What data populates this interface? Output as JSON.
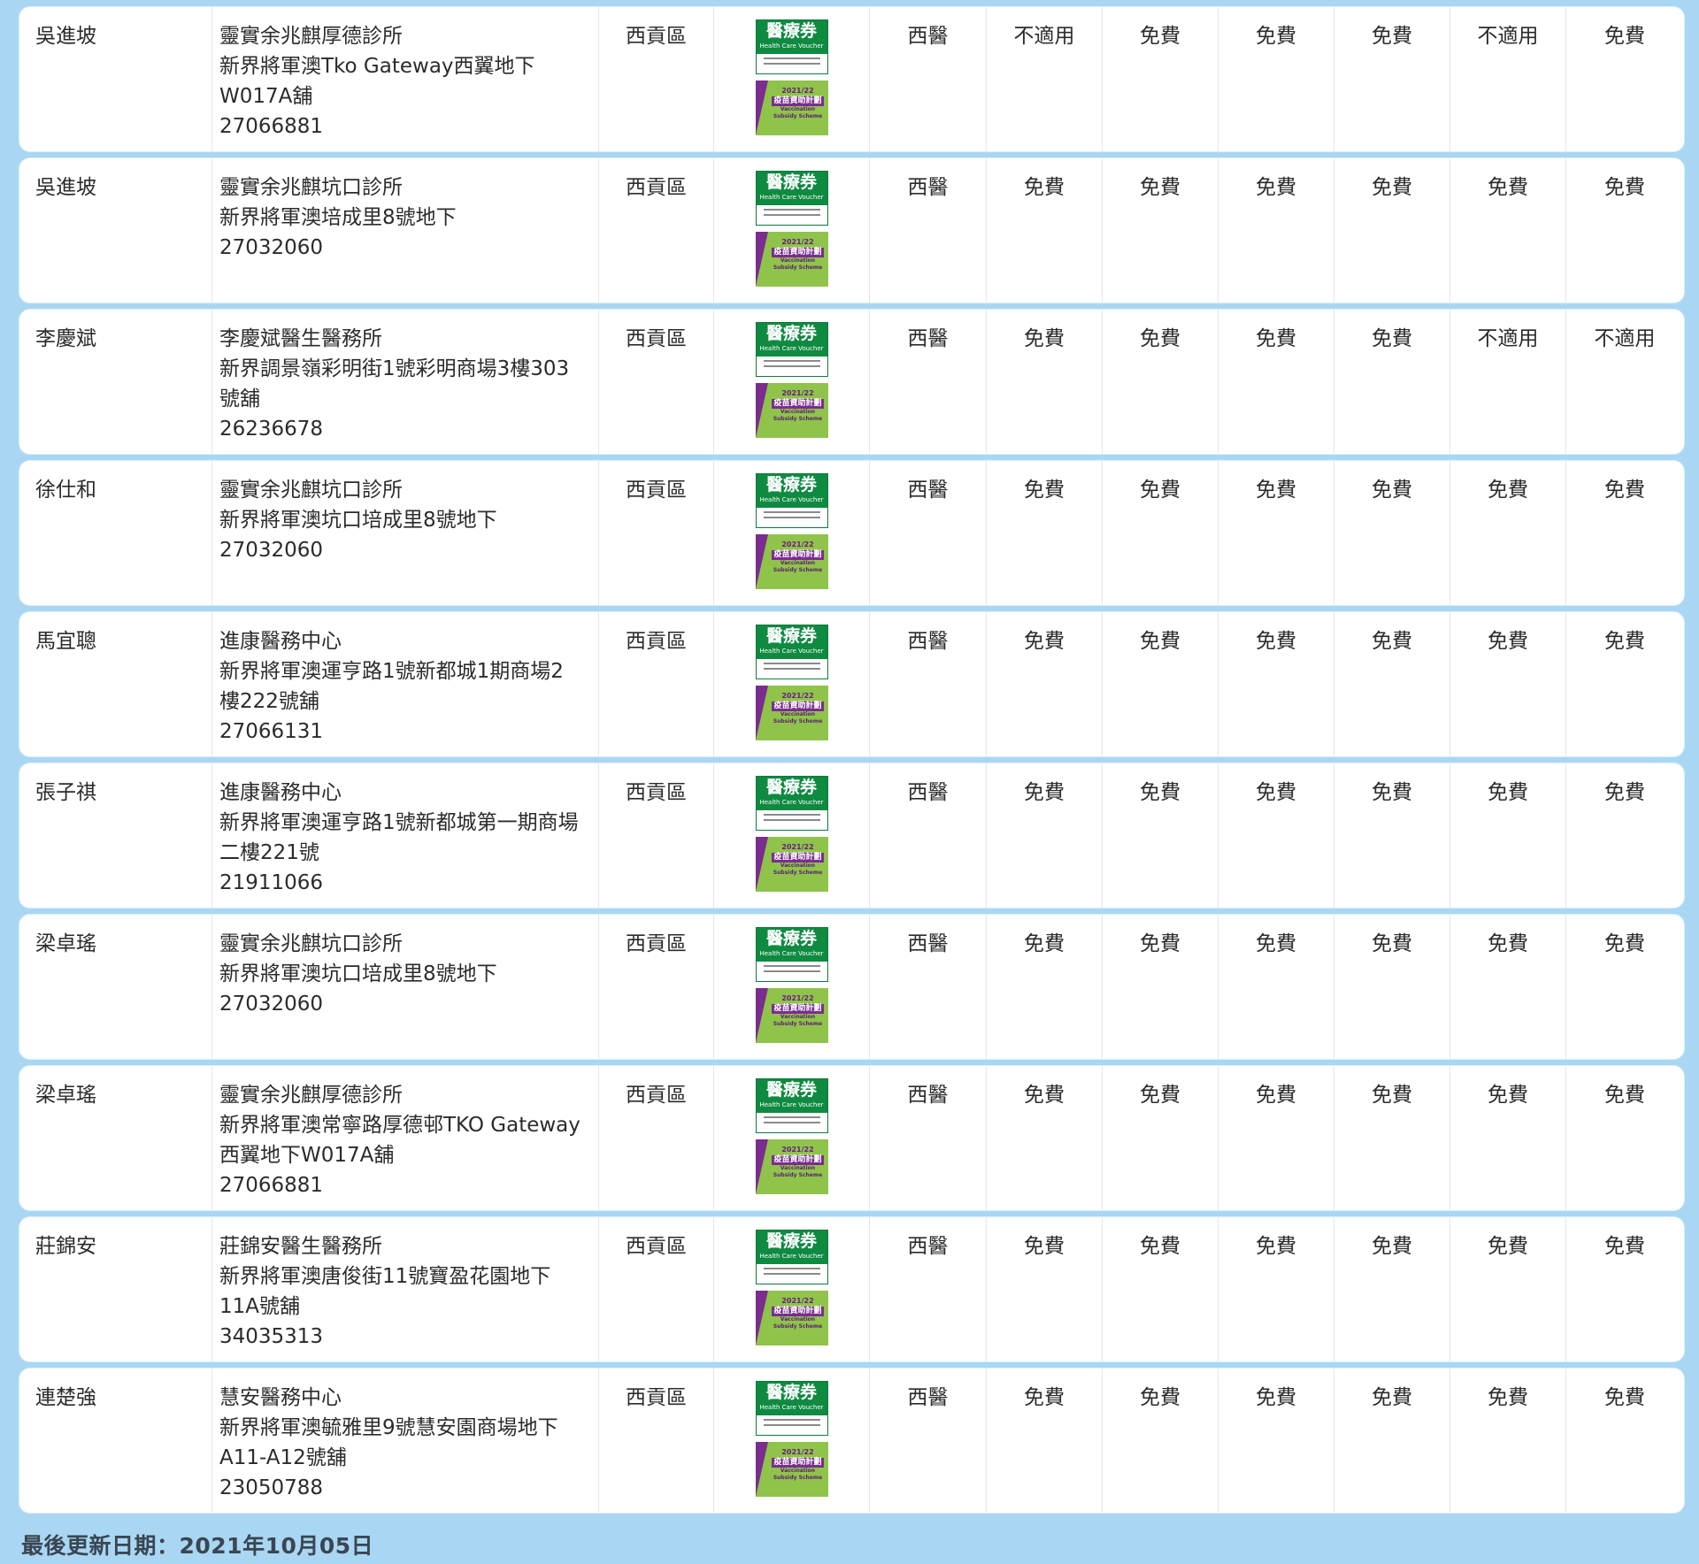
{
  "badges": {
    "hcv_title": "醫療券",
    "hcv_sub": "Health Care Voucher",
    "vss_year": "2021/22",
    "vss_title": "疫苗資助計劃",
    "vss_sub": "Vaccination Subsidy Scheme"
  },
  "rows": [
    {
      "name": "吳進坡",
      "clinic": [
        "靈實余兆麒厚德診所",
        "新界將軍澳Tko Gateway西翼地下",
        "W017A舖",
        "27066881"
      ],
      "district": "西貢區",
      "type": "西醫",
      "fees": [
        "不適用",
        "免費",
        "免費",
        "免費",
        "不適用",
        "免費"
      ]
    },
    {
      "name": "吳進坡",
      "clinic": [
        "靈實余兆麒坑口診所",
        "新界將軍澳培成里8號地下",
        "27032060"
      ],
      "district": "西貢區",
      "type": "西醫",
      "fees": [
        "免費",
        "免費",
        "免費",
        "免費",
        "免費",
        "免費"
      ]
    },
    {
      "name": "李慶斌",
      "clinic": [
        "李慶斌醫生醫務所",
        "新界調景嶺彩明街1號彩明商場3樓303",
        "號舖",
        "26236678"
      ],
      "district": "西貢區",
      "type": "西醫",
      "fees": [
        "免費",
        "免費",
        "免費",
        "免費",
        "不適用",
        "不適用"
      ]
    },
    {
      "name": "徐仕和",
      "clinic": [
        "靈實余兆麒坑口診所",
        "新界將軍澳坑口培成里8號地下",
        "27032060"
      ],
      "district": "西貢區",
      "type": "西醫",
      "fees": [
        "免費",
        "免費",
        "免費",
        "免費",
        "免費",
        "免費"
      ]
    },
    {
      "name": "馬宜聰",
      "clinic": [
        "進康醫務中心",
        "新界將軍澳運亨路1號新都城1期商場2",
        "樓222號舖",
        "27066131"
      ],
      "district": "西貢區",
      "type": "西醫",
      "fees": [
        "免費",
        "免費",
        "免費",
        "免費",
        "免費",
        "免費"
      ]
    },
    {
      "name": "張子祺",
      "clinic": [
        "進康醫務中心",
        "新界將軍澳運亨路1號新都城第一期商場",
        "二樓221號",
        "21911066"
      ],
      "district": "西貢區",
      "type": "西醫",
      "fees": [
        "免費",
        "免費",
        "免費",
        "免費",
        "免費",
        "免費"
      ]
    },
    {
      "name": "梁卓瑤",
      "clinic": [
        "靈實余兆麒坑口診所",
        "新界將軍澳坑口培成里8號地下",
        "27032060"
      ],
      "district": "西貢區",
      "type": "西醫",
      "fees": [
        "免費",
        "免費",
        "免費",
        "免費",
        "免費",
        "免費"
      ]
    },
    {
      "name": "梁卓瑤",
      "clinic": [
        "靈實余兆麒厚德診所",
        "新界將軍澳常寧路厚德邨TKO Gateway",
        "西翼地下W017A舖",
        "27066881"
      ],
      "district": "西貢區",
      "type": "西醫",
      "fees": [
        "免費",
        "免費",
        "免費",
        "免費",
        "免費",
        "免費"
      ]
    },
    {
      "name": "莊錦安",
      "clinic": [
        "莊錦安醫生醫務所",
        "新界將軍澳唐俊街11號寶盈花園地下",
        "11A號舖",
        "34035313"
      ],
      "district": "西貢區",
      "type": "西醫",
      "fees": [
        "免費",
        "免費",
        "免費",
        "免費",
        "免費",
        "免費"
      ]
    },
    {
      "name": "連楚強",
      "clinic": [
        "慧安醫務中心",
        "新界將軍澳毓雅里9號慧安園商場地下",
        "A11-A12號舖",
        "23050788"
      ],
      "district": "西貢區",
      "type": "西醫",
      "fees": [
        "免費",
        "免費",
        "免費",
        "免費",
        "免費",
        "免費"
      ]
    }
  ],
  "footer": {
    "last_updated": "最後更新日期：2021年10月05日"
  }
}
